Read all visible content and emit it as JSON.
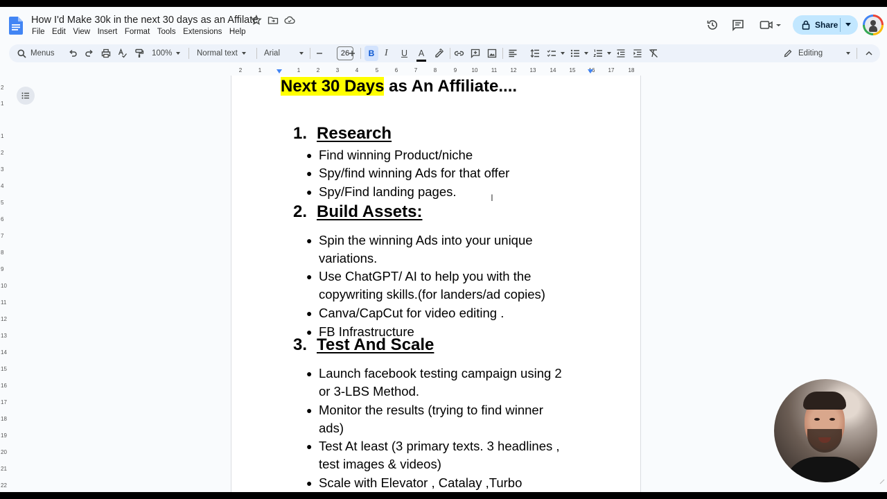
{
  "window": {
    "title": "How I'd Make 30k in the next  30 days as an Affilate"
  },
  "menu": [
    "File",
    "Edit",
    "View",
    "Insert",
    "Format",
    "Tools",
    "Extensions",
    "Help"
  ],
  "header": {
    "share_label": "Share"
  },
  "toolbar": {
    "search_label": "Menus",
    "zoom": "100%",
    "style": "Normal text",
    "font": "Arial",
    "font_size": "26",
    "bold": "B",
    "italic": "I",
    "underline": "U",
    "text_color": "A",
    "mode": "Editing"
  },
  "ruler": {
    "labels": [
      "2",
      "1",
      "1",
      "2",
      "3",
      "4",
      "5",
      "6",
      "7",
      "8",
      "9",
      "10",
      "11",
      "12",
      "13",
      "14",
      "15",
      "16",
      "17",
      "18"
    ],
    "vertical_labels": [
      "2",
      "1",
      "1",
      "2",
      "3",
      "4",
      "5",
      "6",
      "7",
      "8",
      "9",
      "10",
      "11",
      "12",
      "13",
      "14",
      "15",
      "16",
      "17",
      "18",
      "19",
      "20",
      "21",
      "22"
    ]
  },
  "document": {
    "title_highlight": "Next 30 Days",
    "title_rest": " as An Affiliate....",
    "sections": [
      {
        "number": "1.",
        "heading": "Research",
        "bullets": [
          [
            "Find winning Product/niche"
          ],
          [
            "Spy/find winning Ads for that offer"
          ],
          [
            "Spy/Find landing pages."
          ]
        ]
      },
      {
        "number": "2.",
        "heading": "Build Assets:",
        "bullets": [
          [
            "Spin the winning Ads into your unique",
            "variations."
          ],
          [
            "Use ChatGPT/ AI to help you with the",
            "copywriting skills.(for landers/ad copies)"
          ],
          [
            "Canva/CapCut for video editing ."
          ],
          [
            "FB Infrastructure"
          ]
        ]
      },
      {
        "number": "3.",
        "heading": "Test And Scale",
        "bullets": [
          [
            "Launch facebook testing campaign using 2",
            "or 3-LBS Method."
          ],
          [
            "Monitor the results (trying to find winner",
            "ads)"
          ],
          [
            "Test At least (3 primary texts. 3 headlines ,",
            "test images & videos)"
          ],
          [
            "Scale with Elevator , Catalay ,Turbo"
          ]
        ]
      }
    ]
  },
  "colors": {
    "highlight": "#ffff00",
    "share_bg": "#c2e7ff",
    "toolbar_bg": "#edf2fa",
    "doc_blue": "#4285f4"
  }
}
